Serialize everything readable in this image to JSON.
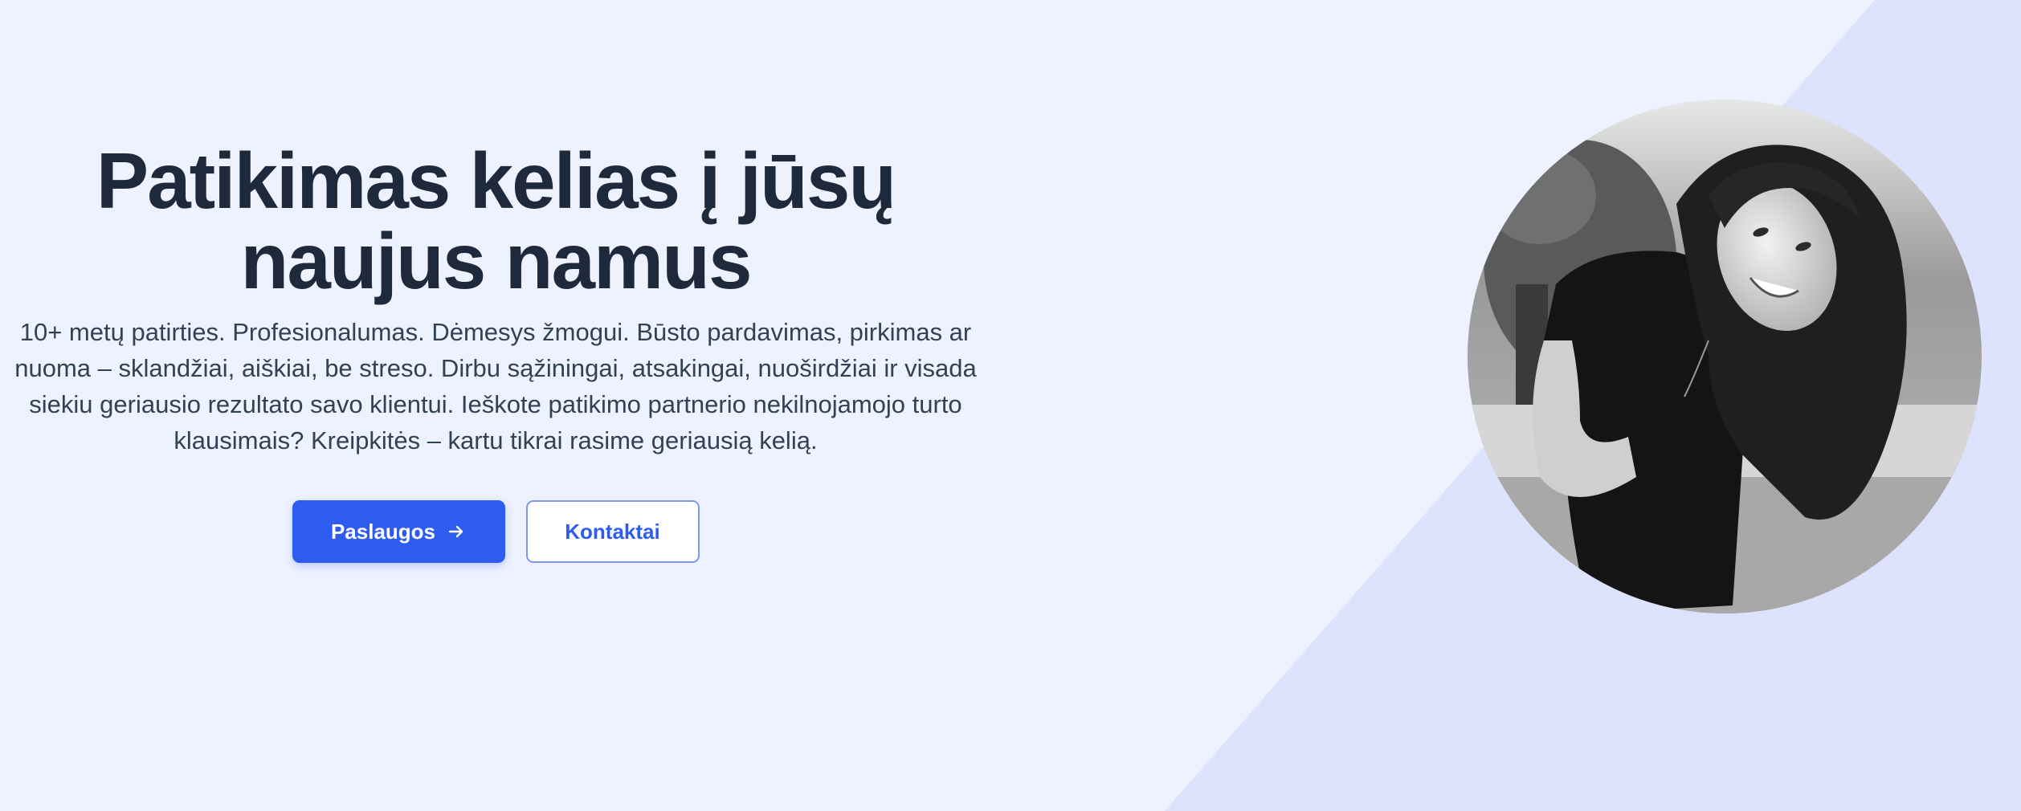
{
  "hero": {
    "headline": "Patikimas kelias į jūsų naujus namus",
    "description": "10+ metų patirties. Profesionalumas. Dėmesys žmogui. Būsto pardavimas, pirkimas ar nuoma – sklandžiai, aiškiai, be streso. Dirbu sąžiningai, atsakingai, nuoširdžiai ir visada siekiu geriausio rezultato savo klientui. Ieškote patikimo partnerio nekilnojamojo turto klausimais? Kreipkitės – kartu tikrai rasime geriausią kelią.",
    "primary_button": {
      "label": "Paslaugos",
      "icon": "arrow-right-icon"
    },
    "secondary_button": {
      "label": "Kontaktai"
    }
  },
  "portrait": {
    "description": "black-and-white photo of a smiling woman with long hair"
  },
  "colors": {
    "background": "#eef2fe",
    "diagonal_panel": "#dde3fc",
    "heading": "#1e293b",
    "body_text": "#334155",
    "accent": "#2f5cf0"
  }
}
